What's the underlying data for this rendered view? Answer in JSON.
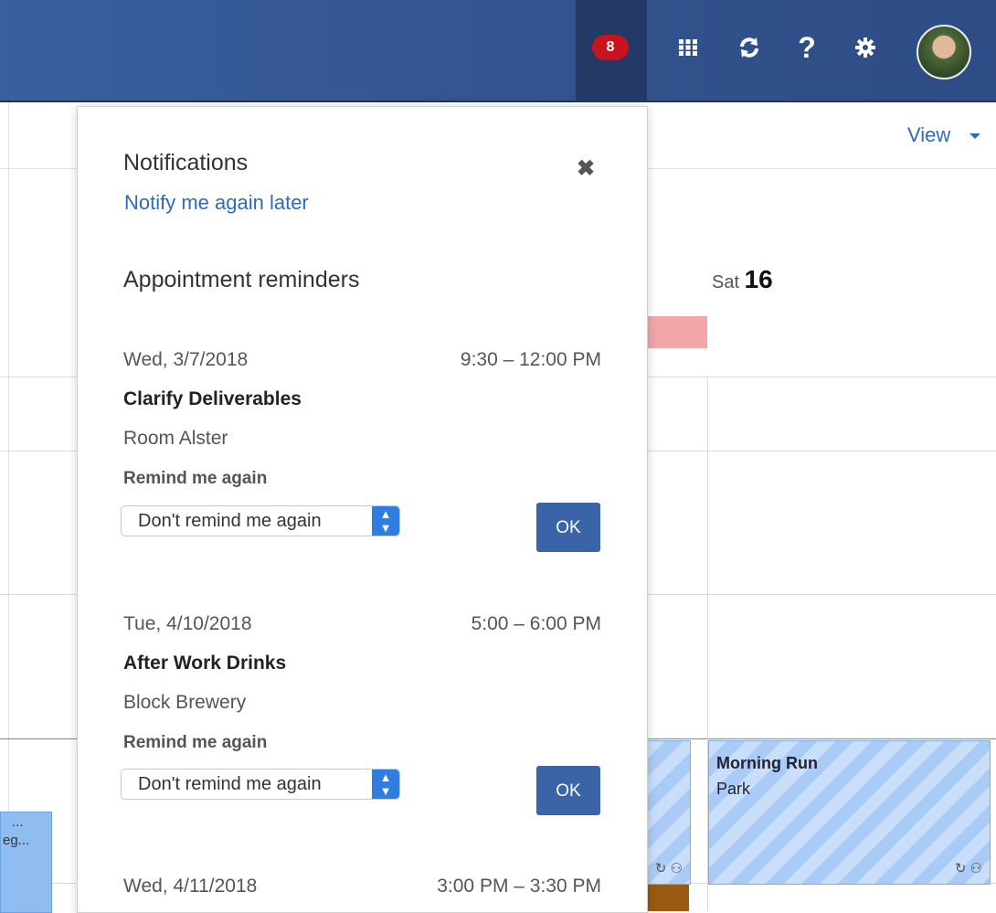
{
  "topbar": {
    "notification_count": "8",
    "icons": [
      "apps-grid-icon",
      "refresh-icon",
      "help-icon",
      "settings-gear-icon"
    ],
    "colors": {
      "bar": "#33548f",
      "badge": "#c8141e"
    }
  },
  "calendar": {
    "view_label": "View",
    "day_header": {
      "name": "Sat",
      "number": "16"
    },
    "events": [
      {
        "title": "Morning Run",
        "location": "Park"
      },
      {
        "title": "...",
        "location": "eg..."
      }
    ]
  },
  "notifications": {
    "title": "Notifications",
    "notify_later": "Notify me again later",
    "section_title": "Appointment reminders",
    "reminders": [
      {
        "date": "Wed, 3/7/2018",
        "time": "9:30 – 12:00 PM",
        "subject": "Clarify Deliverables",
        "location": "Room Alster",
        "remind_label": "Remind me again",
        "remind_value": "Don't remind me again",
        "ok_label": "OK"
      },
      {
        "date": "Tue, 4/10/2018",
        "time": "5:00 – 6:00 PM",
        "subject": "After Work Drinks",
        "location": "Block Brewery",
        "remind_label": "Remind me again",
        "remind_value": "Don't remind me again",
        "ok_label": "OK"
      },
      {
        "date": "Wed, 4/11/2018",
        "time": "3:00 PM – 3:30 PM"
      }
    ]
  }
}
